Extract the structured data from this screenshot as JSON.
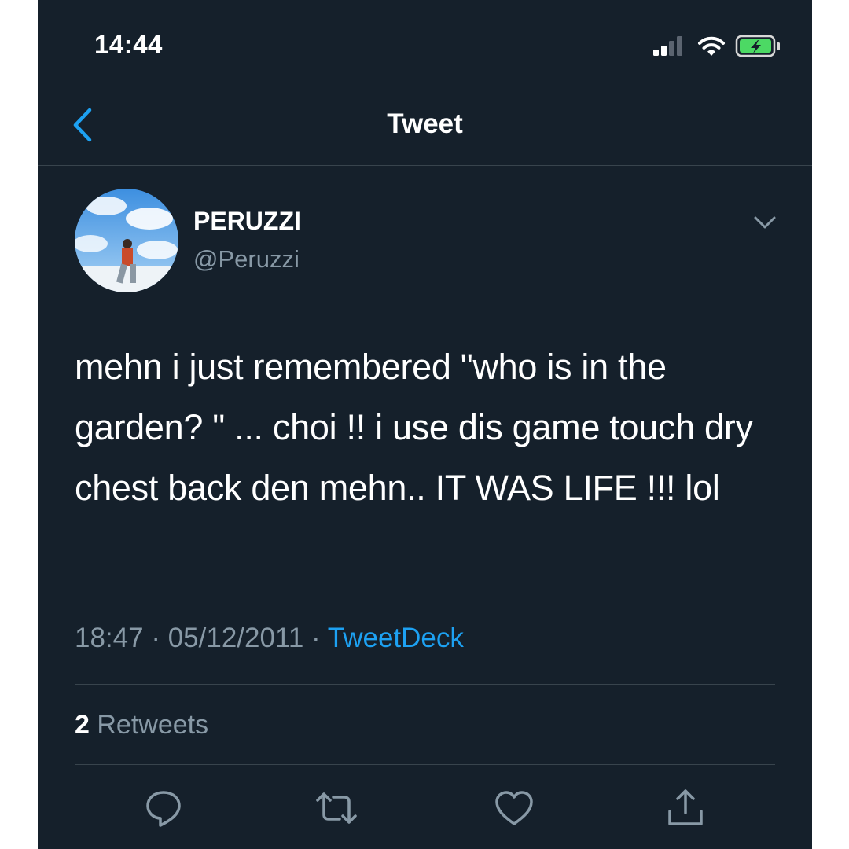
{
  "status_bar": {
    "time": "14:44",
    "signal_icon": "cellular-signal-icon",
    "wifi_icon": "wifi-icon",
    "battery_icon": "battery-charging-icon",
    "battery_color": "#4cd964"
  },
  "nav": {
    "back_icon": "chevron-left-icon",
    "title": "Tweet"
  },
  "author": {
    "display_name": "PERUZZI",
    "handle": "@Peruzzi",
    "avatar_icon": "avatar",
    "menu_icon": "chevron-down-icon"
  },
  "tweet": {
    "text": "mehn i just remembered \"who is in the garden? \" ... choi !! i use dis game touch dry chest back den mehn.. IT WAS LIFE !!! lol",
    "time": "18:47",
    "date": "05/12/2011",
    "separator": "·",
    "source": "TweetDeck"
  },
  "stats": {
    "retweet_count": "2",
    "retweet_label": "Retweets"
  },
  "actions": [
    {
      "name": "reply",
      "icon": "reply-icon"
    },
    {
      "name": "retweet",
      "icon": "retweet-icon"
    },
    {
      "name": "like",
      "icon": "heart-icon"
    },
    {
      "name": "share",
      "icon": "share-icon"
    }
  ],
  "colors": {
    "background": "#15202b",
    "text_primary": "#ffffff",
    "text_secondary": "#8899a6",
    "accent": "#1da1f2",
    "divider": "#38444d"
  }
}
